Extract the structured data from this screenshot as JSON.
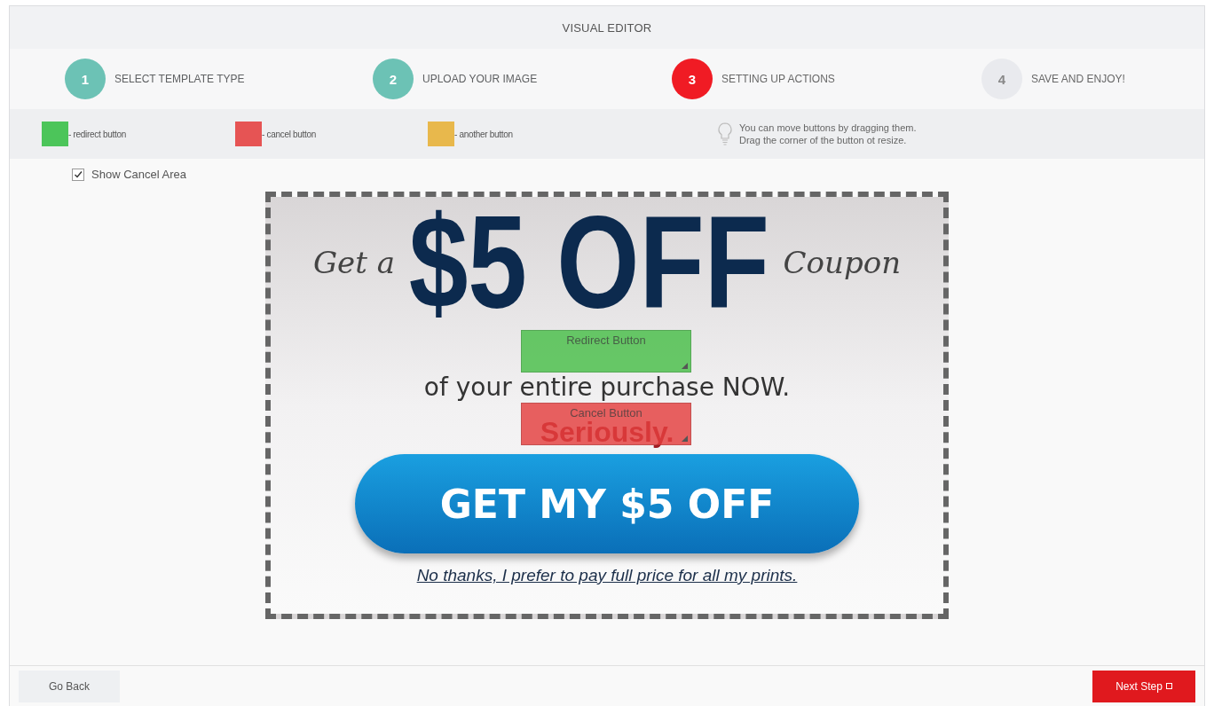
{
  "header": {
    "title": "VISUAL EDITOR"
  },
  "steps": [
    {
      "number": "1",
      "label": "SELECT TEMPLATE TYPE",
      "done": true,
      "selected": false
    },
    {
      "number": "2",
      "label": "UPLOAD YOUR IMAGE",
      "done": true,
      "selected": false
    },
    {
      "number": "3",
      "label": "SETTING UP ACTIONS",
      "done": false,
      "selected": true
    },
    {
      "number": "4",
      "label": "SAVE AND ENJOY!",
      "done": false,
      "selected": false
    }
  ],
  "legend": [
    {
      "label": "- redirect button",
      "color": "#4cc55a"
    },
    {
      "label": "- cancel button",
      "color": "#e65454"
    },
    {
      "label": "- another button",
      "color": "#e8b84c"
    }
  ],
  "hint": {
    "lines": [
      "You can move buttons by dragging them.",
      "Drag the corner of the button ot resize."
    ]
  },
  "show_cancel_area": {
    "label": "Show Cancel Area",
    "checked": true
  },
  "coupon": {
    "lead": "Get a",
    "headline": "$5 OFF",
    "trail": "Coupon",
    "subline": "of your entire purchase NOW.",
    "seriously": "Seriously.",
    "cta": "GET MY $5 OFF",
    "decline": "No thanks, I prefer to pay full price for all my prints."
  },
  "action_areas": [
    {
      "kind": "redirect",
      "label": "Redirect Button"
    },
    {
      "kind": "cancel",
      "label": "Cancel Button"
    }
  ],
  "footer": {
    "back": "Go Back",
    "next": "Next Step"
  }
}
